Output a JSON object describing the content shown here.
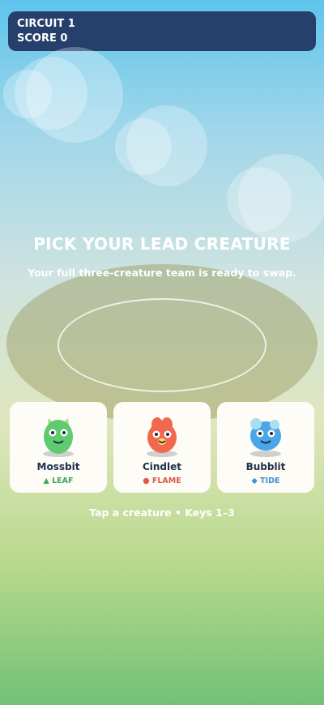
{
  "hud": {
    "circuit": "CIRCUIT 1",
    "score": "SCORE 0"
  },
  "screen": {
    "title": "PICK YOUR LEAD CREATURE",
    "subtitle": "Your full three-creature team is ready to swap.",
    "hint": "Tap a creature • Keys 1–3"
  },
  "creatures": [
    {
      "name": "Mossbit",
      "type_icon": "▲",
      "type": "LEAF",
      "type_color": "#3fa65a",
      "body_color": "#5ecb6e",
      "icon": "leaf-creature-icon"
    },
    {
      "name": "Cindlet",
      "type_icon": "●",
      "type": "FLAME",
      "type_color": "#e2564a",
      "body_color": "#f2684f",
      "icon": "flame-creature-icon"
    },
    {
      "name": "Bubblit",
      "type_icon": "◆",
      "type": "TIDE",
      "type_color": "#3f8fd4",
      "body_color": "#4aa6e8",
      "icon": "tide-creature-icon"
    }
  ]
}
